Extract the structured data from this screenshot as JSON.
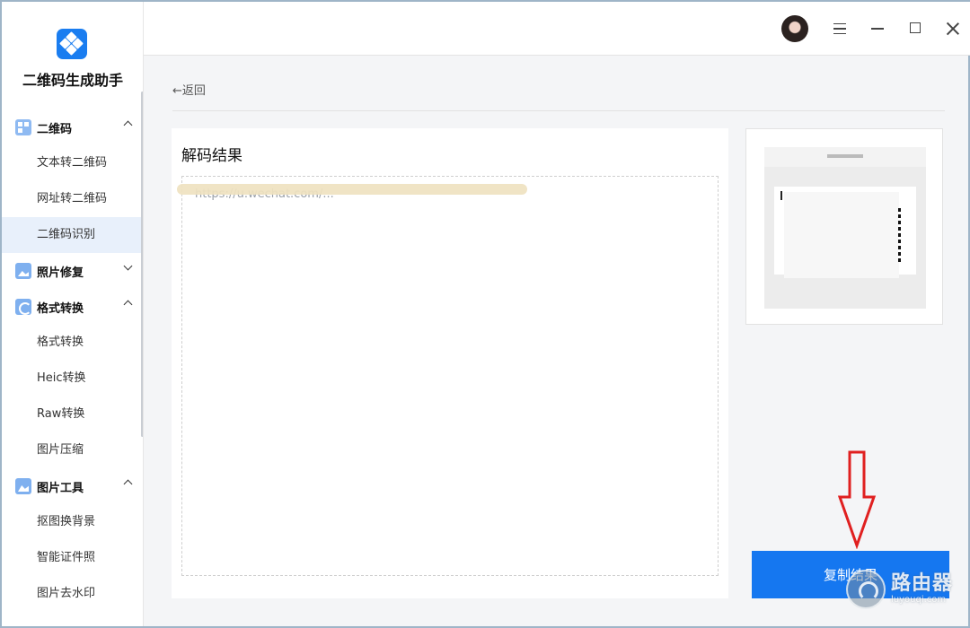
{
  "app": {
    "name": "二维码生成助手"
  },
  "nav": {
    "groups": [
      {
        "label": "二维码",
        "expanded": true,
        "icon": "qr-icon",
        "items": [
          "文本转二维码",
          "网址转二维码",
          "二维码识别"
        ]
      },
      {
        "label": "照片修复",
        "expanded": false,
        "icon": "photo-icon",
        "items": []
      },
      {
        "label": "格式转换",
        "expanded": true,
        "icon": "convert-icon",
        "items": [
          "格式转换",
          "Heic转换",
          "Raw转换",
          "图片压缩"
        ]
      },
      {
        "label": "图片工具",
        "expanded": true,
        "icon": "image-tool-icon",
        "items": [
          "抠图换背景",
          "智能证件照",
          "图片去水印"
        ]
      }
    ],
    "active_item": "二维码识别"
  },
  "back": {
    "label": "←返回"
  },
  "result": {
    "title": "解码结果",
    "text": "https://u.wechat.com/..."
  },
  "copy_button": {
    "label": "复制结果"
  },
  "watermark": {
    "cn": "路由器",
    "en": "luyouqi.com"
  },
  "colors": {
    "accent": "#1577f0",
    "annotation_arrow": "#e02020"
  }
}
